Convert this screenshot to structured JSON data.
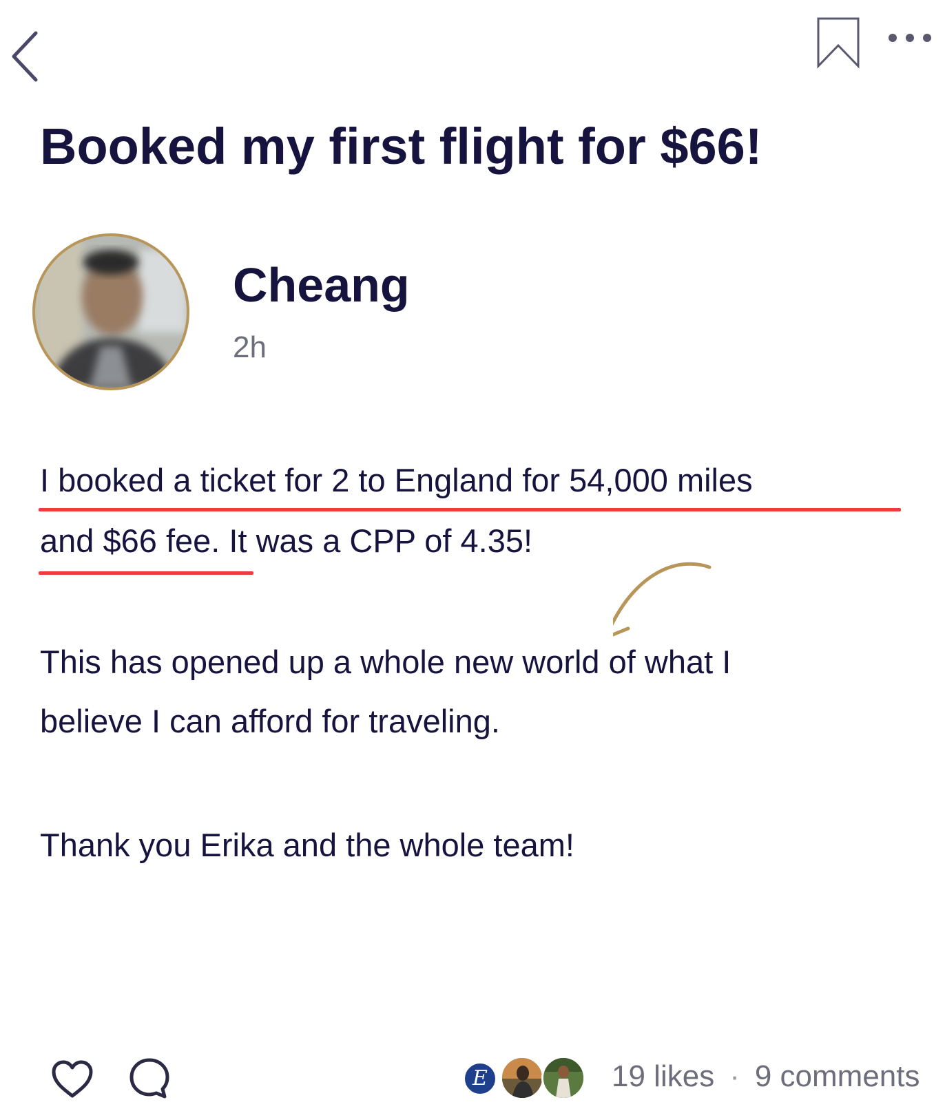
{
  "header": {
    "back_icon": "chevron-left-icon",
    "bookmark_icon": "bookmark-icon",
    "more_icon": "more-horizontal-icon"
  },
  "post": {
    "title": "Booked my first flight for $66!",
    "author": {
      "name": "Cheang",
      "time": "2h"
    },
    "body": {
      "line_1": "I booked a ticket for 2 to England for 54,000 miles",
      "line_2": "and $66 fee. It was a CPP of 4.35!",
      "line_3": "This has opened up a whole new world of what I",
      "line_4": "believe I can afford for traveling.",
      "line_5": "Thank you Erika and the whole team!"
    },
    "highlight_color": "#ef3b3b",
    "annotation_color": "#b8965a"
  },
  "footer": {
    "like_icon": "heart-icon",
    "comment_icon": "comment-bubble-icon",
    "liker_initial": "E",
    "likes_label": "19 likes",
    "separator": "·",
    "comments_label": "9 comments"
  },
  "colors": {
    "text_primary": "#16143f",
    "text_secondary": "#6d6d7c",
    "avatar_ring": "#b8965a"
  }
}
